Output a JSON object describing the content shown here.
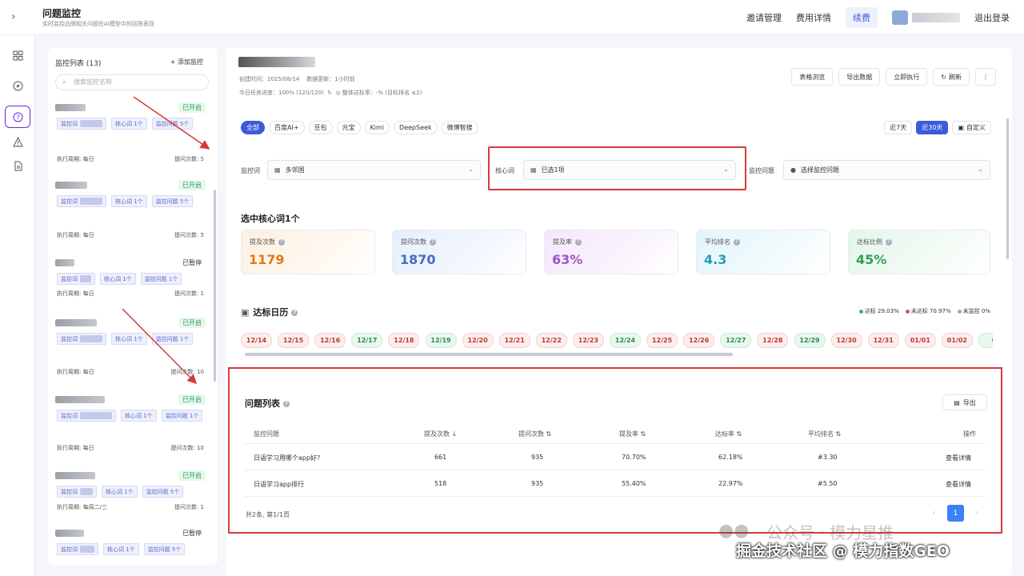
{
  "header": {
    "title": "问题监控",
    "subtitle": "实时监控品牌相关问题在AI模型中的回答表现",
    "links": [
      "邀请管理",
      "费用详情",
      "续费"
    ],
    "logout": "退出登录"
  },
  "monitor_list": {
    "title": "监控列表 (13)",
    "add_label": "+ 添加监控",
    "search_placeholder": "搜索监控名称",
    "items": [
      {
        "status": "已开启",
        "tags": [
          "监控词",
          "核心词 1个",
          "监控问题 5个"
        ],
        "period": "执行周期: 每日",
        "count": "提问次数: 5"
      },
      {
        "status": "已开启",
        "tags": [
          "监控词",
          "核心词 1个",
          "监控问题 5个"
        ],
        "period": "执行周期: 每日",
        "count": "提问次数: 5"
      },
      {
        "status": "已暂停",
        "tags": [
          "监控词",
          "核心词 1个",
          "监控问题 1个"
        ],
        "period": "执行周期: 每日",
        "count": "提问次数: 1"
      },
      {
        "status": "已开启",
        "tags": [
          "监控词",
          "核心词 1个",
          "监控问题 1个"
        ],
        "period": "执行周期: 每日",
        "count": "提问次数: 10"
      },
      {
        "status": "已开启",
        "tags": [
          "监控词",
          "核心词 1个",
          "监控问题 1个"
        ],
        "period": "执行周期: 每日",
        "count": "提问次数: 10"
      },
      {
        "status": "已开启",
        "tags": [
          "监控词",
          "核心词 1个",
          "监控问题 5个"
        ],
        "period": "执行周期: 每周二/三",
        "count": "提问次数: 1"
      },
      {
        "status": "已暂停",
        "tags": [
          "监控词",
          "核心词 1个",
          "监控问题 5个"
        ],
        "period": "",
        "count": ""
      }
    ]
  },
  "detail": {
    "created": "创建时间：2025/08/14",
    "updated": "数据更新：1小时前",
    "progress": "今日任务进度：100% (120/120)",
    "overall": "整体达标率：-% (目标排名 ≤2)",
    "actions": [
      "表格浏览",
      "导出数据",
      "立即执行",
      "刷新"
    ],
    "more": "⋮"
  },
  "filters": {
    "models": [
      "全部",
      "百度AI+",
      "豆包",
      "元宝",
      "Kimi",
      "DeepSeek",
      "微博智搜"
    ],
    "ranges": [
      "近7天",
      "近30天",
      "自定义"
    ],
    "label_monitor": "监控词",
    "value_monitor": "多邻国",
    "label_core": "核心词",
    "value_core": "已选1项",
    "label_question": "监控问题",
    "placeholder_question": "选择监控问题"
  },
  "stats": {
    "heading": "选中核心词1个",
    "cards": [
      {
        "label": "提及次数",
        "value": "1179",
        "color": "#e07a1f"
      },
      {
        "label": "提问次数",
        "value": "1870",
        "color": "#4a6bc4"
      },
      {
        "label": "提及率",
        "value": "63%",
        "color": "#9b55c9"
      },
      {
        "label": "平均排名",
        "value": "4.3",
        "color": "#2a9bb5"
      },
      {
        "label": "达标比例",
        "value": "45%",
        "color": "#2f9e58"
      }
    ]
  },
  "calendar": {
    "heading": "达标日历",
    "legend": [
      "达标 29.03%",
      "未达标 70.97%",
      "未监控 0%"
    ],
    "dates": [
      {
        "d": "12/14",
        "s": "no"
      },
      {
        "d": "12/15",
        "s": "no"
      },
      {
        "d": "12/16",
        "s": "no"
      },
      {
        "d": "12/17",
        "s": "ok"
      },
      {
        "d": "12/18",
        "s": "no"
      },
      {
        "d": "12/19",
        "s": "ok"
      },
      {
        "d": "12/20",
        "s": "no"
      },
      {
        "d": "12/21",
        "s": "no"
      },
      {
        "d": "12/22",
        "s": "no"
      },
      {
        "d": "12/23",
        "s": "no"
      },
      {
        "d": "12/24",
        "s": "ok"
      },
      {
        "d": "12/25",
        "s": "no"
      },
      {
        "d": "12/26",
        "s": "no"
      },
      {
        "d": "12/27",
        "s": "ok"
      },
      {
        "d": "12/28",
        "s": "no"
      },
      {
        "d": "12/29",
        "s": "ok"
      },
      {
        "d": "12/30",
        "s": "no"
      },
      {
        "d": "12/31",
        "s": "no"
      },
      {
        "d": "01/01",
        "s": "no"
      },
      {
        "d": "01/02",
        "s": "no"
      },
      {
        "d": "0",
        "s": "ok"
      }
    ]
  },
  "questions": {
    "heading": "问题列表",
    "export": "导出",
    "columns": [
      "监控问题",
      "提及次数 ↓",
      "提问次数 ⇅",
      "提及率 ⇅",
      "达标率 ⇅",
      "平均排名 ⇅",
      "操作"
    ],
    "rows": [
      [
        "日语学习用哪个app好?",
        "661",
        "935",
        "70.70%",
        "62.18%",
        "#3.30",
        "查看详情"
      ],
      [
        "日语学习app排行",
        "518",
        "935",
        "55.40%",
        "22.97%",
        "#5.50",
        "查看详情"
      ]
    ],
    "summary": "共2条, 第1/1页",
    "page": "1",
    "prev": "‹",
    "next": "›"
  },
  "watermark": {
    "line1": "公众号 · 模力星推",
    "line2": "掘金技术社区 @ 模力指数GEO"
  }
}
